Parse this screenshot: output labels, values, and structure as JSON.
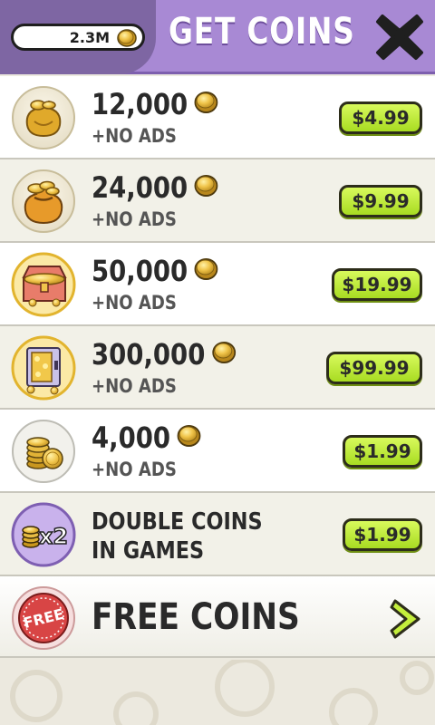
{
  "header": {
    "balance": "2.3M",
    "title": "GET COINS",
    "close_icon": "close-x-icon"
  },
  "colors": {
    "header_bg": "#a889d4",
    "balance_tab_bg": "#7e66a3",
    "price_button": "#c4ee3c",
    "coin_gold": "#e2b850",
    "free_badge_red": "#d84545"
  },
  "offers": [
    {
      "amount": "12,000",
      "sub": "+NO ADS",
      "price": "$4.99",
      "icon": "small-coin-bag-icon"
    },
    {
      "amount": "24,000",
      "sub": "+NO ADS",
      "price": "$9.99",
      "icon": "large-coin-bag-icon"
    },
    {
      "amount": "50,000",
      "sub": "+NO ADS",
      "price": "$19.99",
      "icon": "treasure-chest-icon"
    },
    {
      "amount": "300,000",
      "sub": "+NO ADS",
      "price": "$99.99",
      "icon": "coin-vault-icon"
    },
    {
      "amount": "4,000",
      "sub": "+NO ADS",
      "price": "$1.99",
      "icon": "coin-stack-icon"
    }
  ],
  "double_coins": {
    "label": "DOUBLE COINS IN GAMES",
    "price": "$1.99",
    "badge": "x2",
    "icon": "double-coins-icon"
  },
  "free_coins": {
    "label": "FREE COINS",
    "badge": "FREE",
    "icon": "free-stamp-icon",
    "arrow_icon": "chevron-right-icon"
  }
}
